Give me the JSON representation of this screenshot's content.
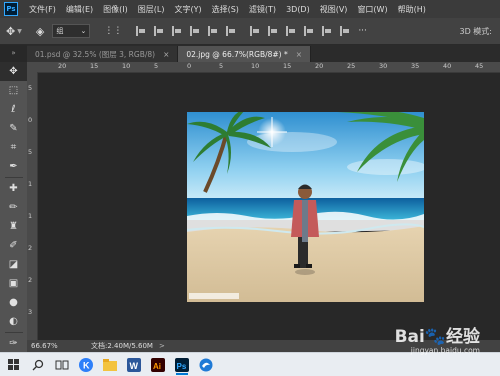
{
  "app": {
    "logo_text": "Ps"
  },
  "menu": [
    "文件(F)",
    "编辑(E)",
    "图像(I)",
    "图层(L)",
    "文字(Y)",
    "选择(S)",
    "滤镜(T)",
    "3D(D)",
    "视图(V)",
    "窗口(W)",
    "帮助(H)"
  ],
  "options": {
    "auto_select_value": "组",
    "mode_3d": "3D 模式:"
  },
  "tabs": [
    {
      "label": "01.psd @ 32.5% (图层 3, RGB/8)",
      "close": "×",
      "active": false
    },
    {
      "label": "02.jpg @ 66.7%(RGB/8#) *",
      "close": "×",
      "active": true
    }
  ],
  "ruler_h": [
    "20",
    "15",
    "10",
    "5",
    "0",
    "5",
    "10",
    "15",
    "20",
    "25",
    "30",
    "35",
    "40",
    "45"
  ],
  "ruler_v": [
    "5",
    "0",
    "5",
    "1",
    "1",
    "2",
    "2",
    "3"
  ],
  "status": {
    "zoom": "66.67%",
    "doc": "文档:2.40M/5.60M",
    "arrow": ">"
  },
  "watermark": {
    "main": "Bai🐾经验",
    "sub": "jingyan.baidu.com"
  },
  "colors": {
    "menubar": "#3b3b3b",
    "panel": "#535353",
    "workspace": "#282828",
    "accent": "#31a8ff"
  },
  "tools": [
    "move-icon",
    "marquee-icon",
    "lasso-icon",
    "quick-select-icon",
    "crop-icon",
    "eyedropper-icon",
    "healing-icon",
    "brush-icon",
    "stamp-icon",
    "history-brush-icon",
    "eraser-icon",
    "gradient-icon",
    "blur-icon",
    "dodge-icon",
    "pen-icon",
    "type-icon"
  ],
  "taskbar": [
    "windows-start-icon",
    "search-icon",
    "task-view-icon",
    "app-k-icon",
    "file-explorer-icon",
    "word-icon",
    "illustrator-icon",
    "photoshop-icon",
    "edge-icon"
  ]
}
